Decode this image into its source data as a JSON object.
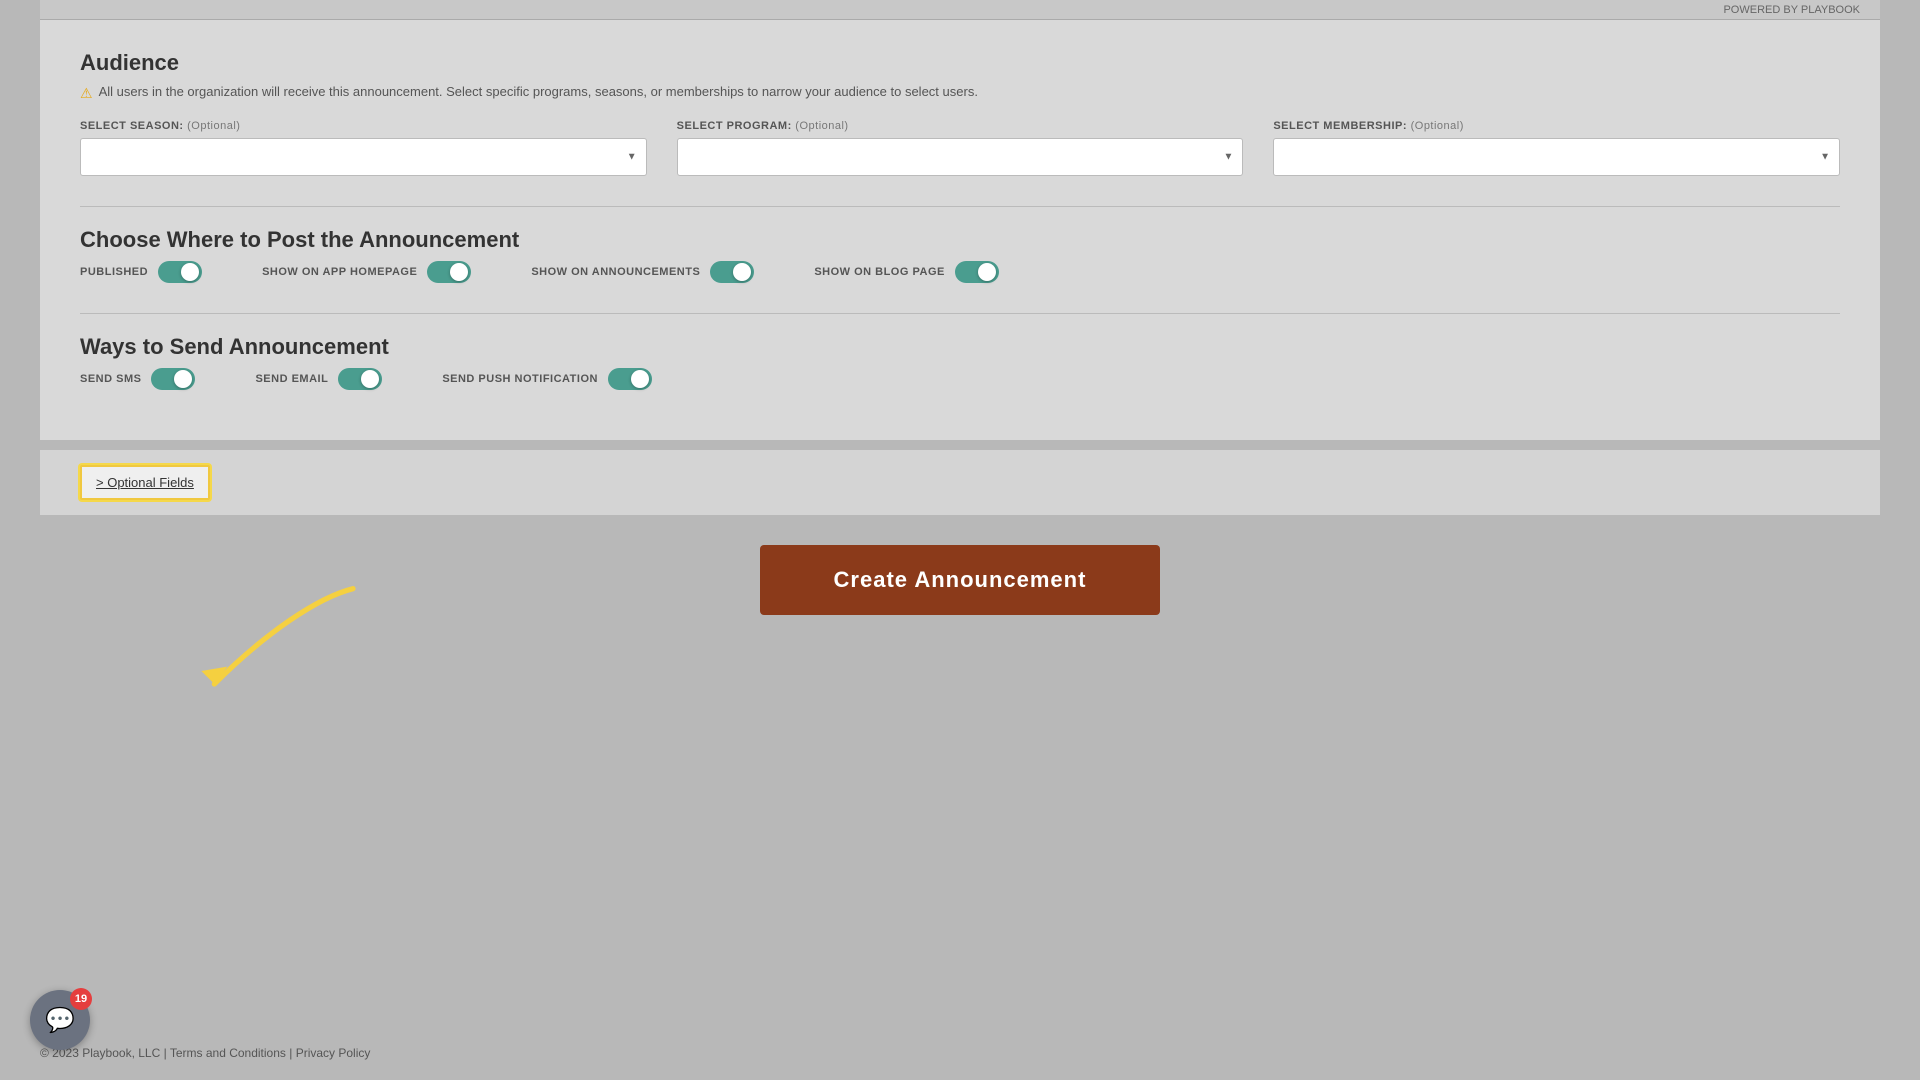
{
  "topbar": {
    "powered_by": "POWERED BY PLAYBOOK"
  },
  "audience": {
    "title": "Audience",
    "description": "All users in the organization will receive this announcement. Select specific programs, seasons, or memberships to narrow your audience to select users.",
    "select_season_label": "SELECT SEASON:",
    "select_season_optional": "(Optional)",
    "select_program_label": "SELECT PROGRAM:",
    "select_program_optional": "(Optional)",
    "select_membership_label": "SELECT MEMBERSHIP:",
    "select_membership_optional": "(Optional)"
  },
  "post_section": {
    "title": "Choose Where to Post the Announcement",
    "toggles": [
      {
        "label": "PUBLISHED",
        "on": true
      },
      {
        "label": "SHOW ON APP HOMEPAGE",
        "on": true
      },
      {
        "label": "SHOW ON ANNOUNCEMENTS",
        "on": true
      },
      {
        "label": "SHOW ON BLOG PAGE",
        "on": true
      }
    ]
  },
  "send_section": {
    "title": "Ways to Send Announcement",
    "toggles": [
      {
        "label": "SEND SMS",
        "on": true
      },
      {
        "label": "SEND EMAIL",
        "on": true
      },
      {
        "label": "SEND PUSH NOTIFICATION",
        "on": true
      }
    ]
  },
  "optional_fields": {
    "label": "> Optional Fields"
  },
  "create_button": {
    "label": "Create Announcement"
  },
  "footer": {
    "copyright": "© 2023 Playbook, LLC",
    "terms": "Terms and Conditions",
    "separator1": " | ",
    "privacy": "Privacy Policy"
  },
  "chat": {
    "badge_count": "19"
  }
}
